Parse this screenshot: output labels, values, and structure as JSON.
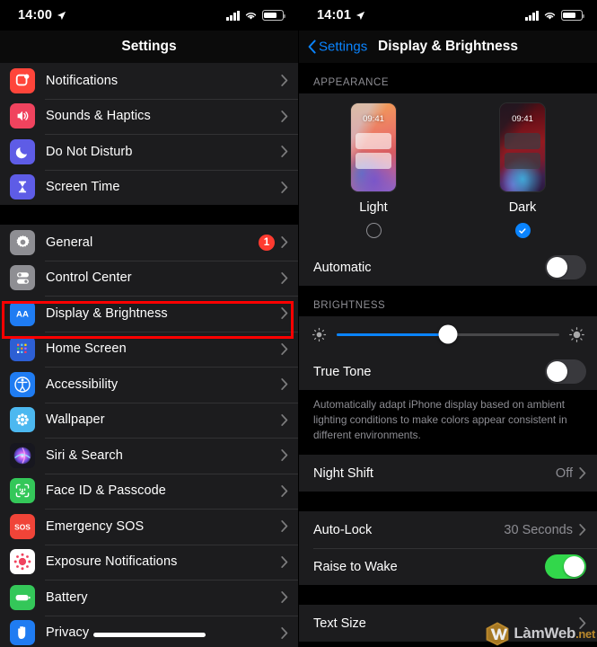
{
  "left_pane": {
    "status_bar": {
      "time": "14:00",
      "location_icon": "location-arrow-icon",
      "signal_icon": "cellular-signal-icon",
      "wifi_icon": "wifi-icon",
      "battery_icon": "battery-icon"
    },
    "nav_title": "Settings",
    "groups": [
      {
        "items": [
          {
            "label": "Notifications",
            "icon": "notifications-icon",
            "icon_color": "#ff453a",
            "badge": null
          },
          {
            "label": "Sounds & Haptics",
            "icon": "sounds-haptics-icon",
            "icon_color": "#f0435e",
            "badge": null
          },
          {
            "label": "Do Not Disturb",
            "icon": "do-not-disturb-icon",
            "icon_color": "#5e5ce6",
            "badge": null
          },
          {
            "label": "Screen Time",
            "icon": "screen-time-icon",
            "icon_color": "#5e5ce6",
            "badge": null
          }
        ]
      },
      {
        "items": [
          {
            "label": "General",
            "icon": "general-gear-icon",
            "icon_color": "#8e8e93",
            "badge": "1"
          },
          {
            "label": "Control Center",
            "icon": "control-center-icon",
            "icon_color": "#8e8e93",
            "badge": null
          },
          {
            "label": "Display & Brightness",
            "icon": "display-brightness-icon",
            "icon_color": "#1f7cf2",
            "badge": null,
            "highlighted": true
          },
          {
            "label": "Home Screen",
            "icon": "home-screen-icon",
            "icon_color": "#2d5fd4",
            "badge": null
          },
          {
            "label": "Accessibility",
            "icon": "accessibility-icon",
            "icon_color": "#1f7cf2",
            "badge": null
          },
          {
            "label": "Wallpaper",
            "icon": "wallpaper-icon",
            "icon_color": "#4cb8f0",
            "badge": null
          },
          {
            "label": "Siri & Search",
            "icon": "siri-search-icon",
            "icon_color": "#2b2b3a",
            "badge": null
          },
          {
            "label": "Face ID & Passcode",
            "icon": "face-id-icon",
            "icon_color": "#34c759",
            "badge": null
          },
          {
            "label": "Emergency SOS",
            "icon": "emergency-sos-icon",
            "icon_color": "#f04438",
            "badge": null
          },
          {
            "label": "Exposure Notifications",
            "icon": "exposure-notifications-icon",
            "icon_color": "#ffffff",
            "badge": null
          },
          {
            "label": "Battery",
            "icon": "battery-settings-icon",
            "icon_color": "#34c759",
            "badge": null
          },
          {
            "label": "Privacy",
            "icon": "privacy-hand-icon",
            "icon_color": "#1f7cf2",
            "badge": null
          }
        ]
      }
    ]
  },
  "right_pane": {
    "status_bar": {
      "time": "14:01",
      "location_icon": "location-arrow-icon",
      "signal_icon": "cellular-signal-icon",
      "wifi_icon": "wifi-icon",
      "battery_icon": "battery-icon"
    },
    "nav": {
      "back_label": "Settings",
      "back_icon": "chevron-left-icon",
      "title": "Display & Brightness"
    },
    "appearance": {
      "header": "APPEARANCE",
      "options": [
        {
          "name": "Light",
          "thumb_clock": "09:41",
          "selected": false
        },
        {
          "name": "Dark",
          "thumb_clock": "09:41",
          "selected": true,
          "highlighted": true
        }
      ],
      "automatic": {
        "label": "Automatic",
        "value": "off"
      }
    },
    "brightness": {
      "header": "BRIGHTNESS",
      "slider": {
        "value_percent": 50,
        "low_icon": "brightness-low-icon",
        "high_icon": "brightness-high-icon"
      },
      "true_tone": {
        "label": "True Tone",
        "value": "off"
      },
      "footnote": "Automatically adapt iPhone display based on ambient lighting conditions to make colors appear consistent in different environments."
    },
    "night_shift": {
      "label": "Night Shift",
      "value": "Off"
    },
    "lock": {
      "auto_lock": {
        "label": "Auto-Lock",
        "value": "30 Seconds"
      },
      "raise_to_wake": {
        "label": "Raise to Wake",
        "value": "on"
      }
    },
    "text_size": {
      "label": "Text Size"
    }
  },
  "watermark": {
    "text": "LàmWeb",
    "suffix": ".net",
    "logo_icon": "lamweb-hex-w-logo"
  },
  "colors": {
    "accent_blue": "#0a84ff",
    "toggle_on_green": "#32d74b",
    "badge_red": "#ff3b30",
    "highlight_red": "#ff0000",
    "row_bg": "#1c1c1e",
    "page_bg": "#000000",
    "secondary_text": "#8d8d93"
  }
}
